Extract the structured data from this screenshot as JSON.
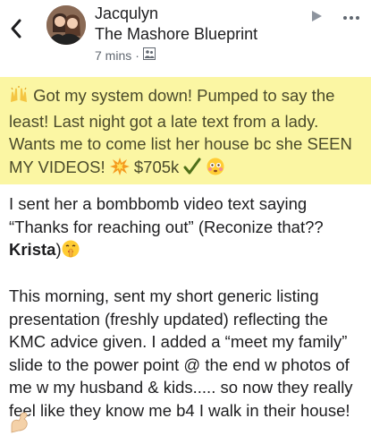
{
  "header": {
    "author": "Jacqulyn",
    "group": "The Mashore Blueprint",
    "time": "7 mins",
    "separator": "·"
  },
  "icons": {
    "back": "chevron-left-icon",
    "avatar": "avatar",
    "privacy": "members-icon",
    "arrow": "play-arrow-icon",
    "more": "more-options-icon"
  },
  "colors": {
    "highlight": "#fbf6a3",
    "highlight_text": "#4a4a2a",
    "meta": "#606770"
  },
  "post": {
    "highlight_text": "Got my system down!  Pumped to say the least!  Last night got a late text from a lady. Wants me to come list her house bc she SEEN MY VIDEOS!",
    "highlight_price": "$705k",
    "p1_text": "I sent her a bombbomb video text saying “Thanks for reaching out” (Reconize that?? ",
    "p1_name": "Krista",
    "p1_close": ")",
    "p2_text": "This morning, sent my short generic listing presentation (freshly updated) reflecting the KMC advice given. I added a “meet my family” slide to the power point @ the end w photos of me w my husband & kids..... so now they really feel like they know me b4 I walk in their house!"
  }
}
